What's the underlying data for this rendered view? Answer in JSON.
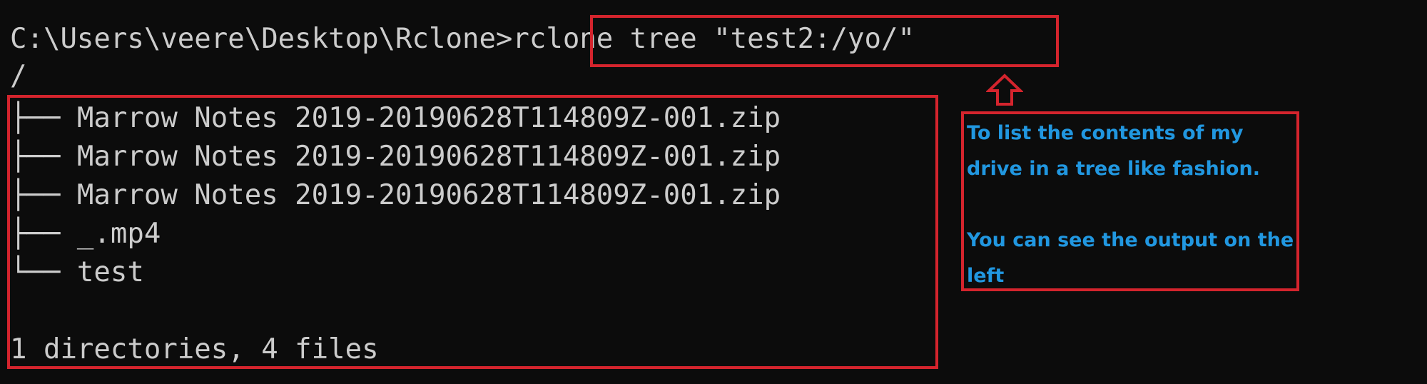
{
  "terminal": {
    "prompt": "C:\\Users\\veere\\Desktop\\Rclone>",
    "command": "rclone tree \"test2:/yo/\"",
    "root": "/",
    "tree": [
      {
        "branch": "├── ",
        "name": "Marrow Notes 2019-20190628T114809Z-001.zip"
      },
      {
        "branch": "├── ",
        "name": "Marrow Notes 2019-20190628T114809Z-001.zip"
      },
      {
        "branch": "├── ",
        "name": "Marrow Notes 2019-20190628T114809Z-001.zip"
      },
      {
        "branch": "├── ",
        "name": "_.mp4"
      },
      {
        "branch": "└── ",
        "name": "test"
      }
    ],
    "summary": "1 directories, 4 files"
  },
  "annotation": {
    "line1": "To list the contents of my drive in a tree like fashion.",
    "line2": "You can see the output on the left",
    "arrow_icon": "up-arrow-icon",
    "highlight_color": "#d4242d",
    "text_color": "#2197e0"
  }
}
